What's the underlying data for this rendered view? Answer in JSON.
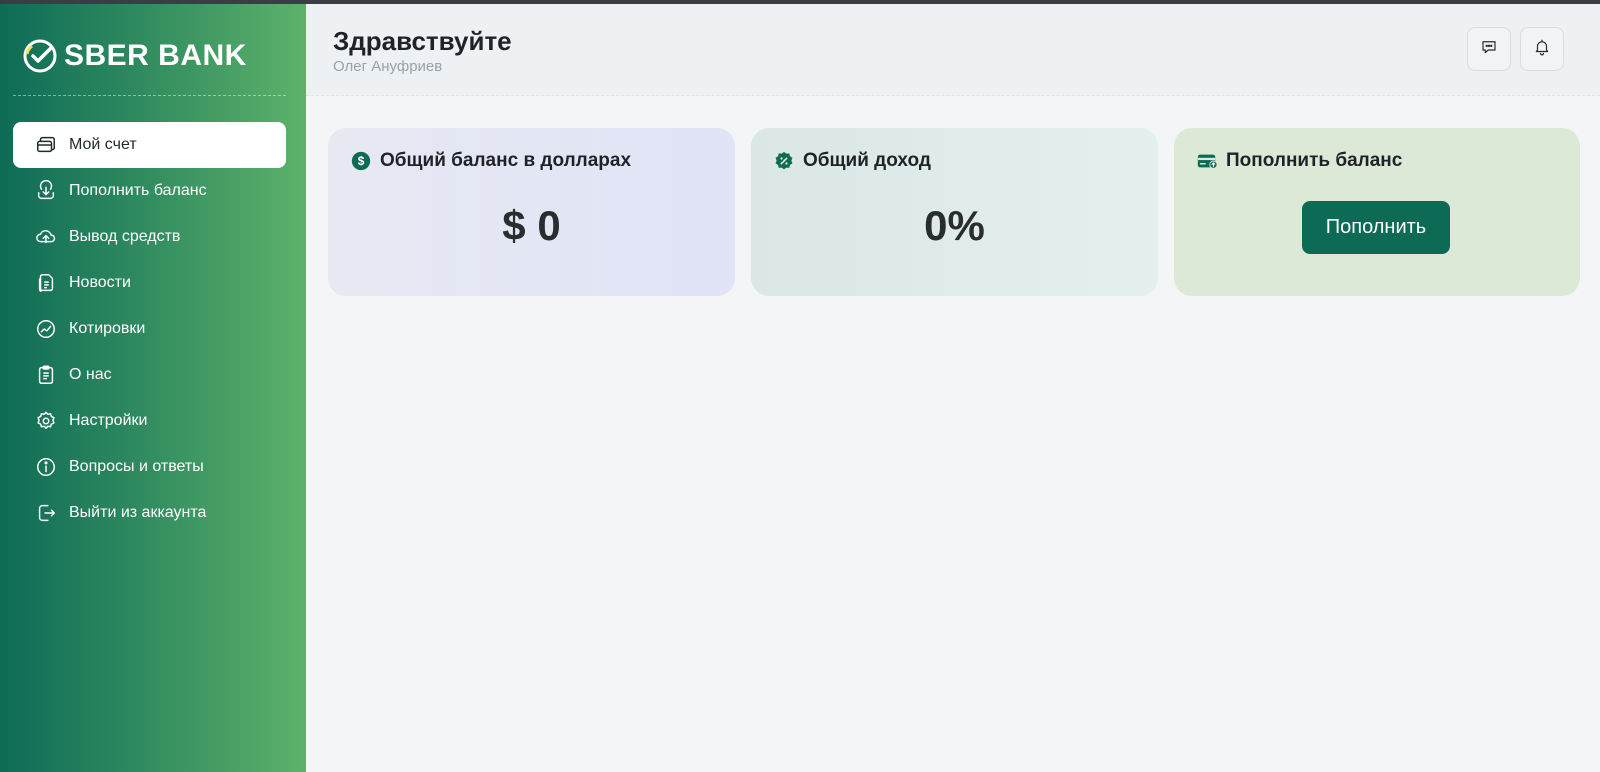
{
  "brand": {
    "name": "SBER BANK",
    "logo_icon": "sber-check-logo"
  },
  "sidebar": {
    "items": [
      {
        "label": "Мой счет",
        "icon": "wallet-icon",
        "active": true
      },
      {
        "label": "Пополнить баланс",
        "icon": "download-icon",
        "active": false
      },
      {
        "label": "Вывод средств",
        "icon": "upload-cloud-icon",
        "active": false
      },
      {
        "label": "Новости",
        "icon": "documents-icon",
        "active": false
      },
      {
        "label": "Котировки",
        "icon": "trend-chart-icon",
        "active": false
      },
      {
        "label": "О нас",
        "icon": "clipboard-icon",
        "active": false
      },
      {
        "label": "Настройки",
        "icon": "gear-icon",
        "active": false
      },
      {
        "label": "Вопросы и ответы",
        "icon": "info-icon",
        "active": false
      },
      {
        "label": "Выйти из аккаунта",
        "icon": "logout-icon",
        "active": false
      }
    ]
  },
  "header": {
    "greeting": "Здравствуйте",
    "user_name": "Олег Ануфриев",
    "actions": [
      "chat-icon",
      "bell-icon"
    ]
  },
  "cards": {
    "balance": {
      "title": "Общий баланс в долларах",
      "value": "$ 0",
      "icon": "dollar-circle-icon"
    },
    "income": {
      "title": "Общий доход",
      "value": "0%",
      "icon": "percent-badge-icon"
    },
    "topup": {
      "title": "Пополнить баланс",
      "button_label": "Пополнить",
      "icon": "card-topup-icon"
    }
  },
  "colors": {
    "accent": "#0d6a55",
    "sidebar_gradient_start": "#0e6b56",
    "sidebar_gradient_end": "#5db26a",
    "balance_card_bg": "#e2e6f5",
    "income_card_bg": "#dfebea",
    "topup_card_bg": "#dbe9d6"
  }
}
